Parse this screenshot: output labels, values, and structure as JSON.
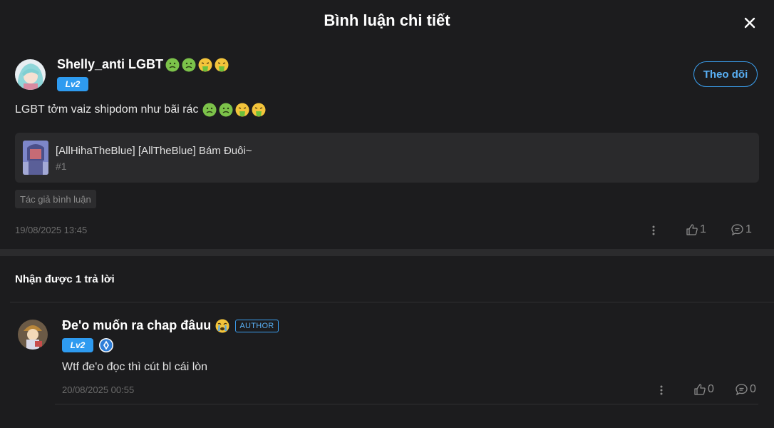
{
  "header": {
    "title": "Bình luận chi tiết"
  },
  "comment": {
    "username": "Shelly_anti LGBT",
    "level": "Lv2",
    "follow_label": "Theo dõi",
    "text": "LGBT tởm vaiz shipdom như bãi rác",
    "chapter": {
      "title": "[AllHihaTheBlue] [AllTheBlue] Bám Đuôi~",
      "number": "#1"
    },
    "tag": "Tác giả bình luận",
    "timestamp": "19/08/2025 13:45",
    "likes": "1",
    "replies": "1"
  },
  "replies_section": {
    "title": "Nhận được 1 trả lời"
  },
  "reply": {
    "username": "Đe'o muốn ra chap đâuu",
    "author_badge": "AUTHOR",
    "level": "Lv2",
    "text": "Wtf đe'o đọc thì cút bl cái lòn",
    "timestamp": "20/08/2025 00:55",
    "likes": "0",
    "replies": "0"
  },
  "colors": {
    "background": "#1c1c1e",
    "accent": "#2e9bf0",
    "card": "#2a2a2c"
  }
}
